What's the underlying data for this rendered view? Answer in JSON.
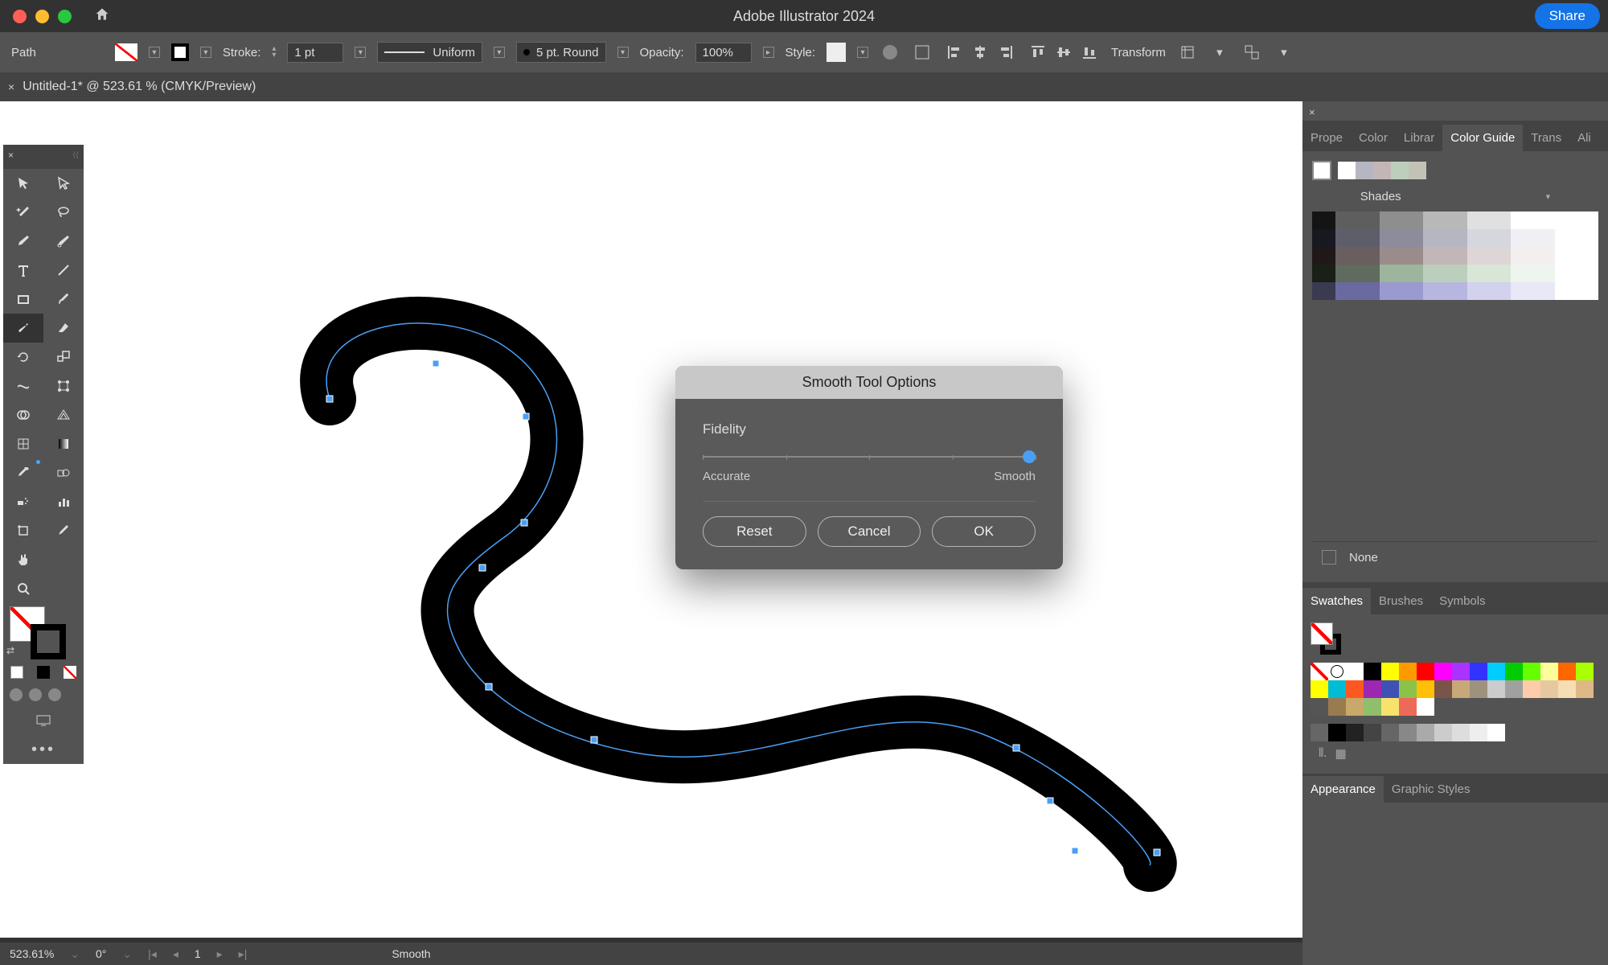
{
  "app": {
    "title": "Adobe Illustrator 2024",
    "share": "Share"
  },
  "control": {
    "selection": "Path",
    "stroke_label": "Stroke:",
    "stroke_weight": "1 pt",
    "profile": "Uniform",
    "var_width": "5 pt. Round",
    "opacity_label": "Opacity:",
    "opacity_value": "100%",
    "style_label": "Style:",
    "transform": "Transform"
  },
  "tab": {
    "close": "×",
    "name": "Untitled-1* @ 523.61 % (CMYK/Preview)"
  },
  "dialog": {
    "title": "Smooth Tool Options",
    "fidelity": "Fidelity",
    "accurate": "Accurate",
    "smooth": "Smooth",
    "slider_value": 100,
    "reset": "Reset",
    "cancel": "Cancel",
    "ok": "OK"
  },
  "panels": {
    "tabs": [
      "Prope",
      "Color",
      "Librar",
      "Color Guide",
      "Trans",
      "Ali"
    ],
    "active_tab": "Color Guide",
    "shades": "Shades",
    "none": "None",
    "tabs2": [
      "Swatches",
      "Brushes",
      "Symbols"
    ],
    "active_tab2": "Swatches",
    "tabs3": [
      "Appearance",
      "Graphic Styles"
    ],
    "active_tab3": "Appearance"
  },
  "colorguide": {
    "harmony": [
      "#ffffff",
      "#b6b6c2",
      "#c2b6b6",
      "#bccfbc",
      "#c2c2b6"
    ],
    "shades_grid": [
      [
        "#141414",
        "#5e5e5e",
        "#8e8e8e",
        "#b8b8b8",
        "#e0e0e0",
        "#ffffff",
        "#ffffff"
      ],
      [
        "#181820",
        "#5e5e6b",
        "#8c8c9b",
        "#b6b6c2",
        "#d6d6de",
        "#efeff4",
        "#ffffff"
      ],
      [
        "#201818",
        "#6b5e5e",
        "#9b8c8c",
        "#c2b6b6",
        "#ded6d6",
        "#f4efef",
        "#ffffff"
      ],
      [
        "#182018",
        "#5e6b5e",
        "#9db59d",
        "#bccfbc",
        "#d8e6d8",
        "#eef5ee",
        "#ffffff"
      ],
      [
        "#3a3a50",
        "#6a6aa0",
        "#9a9ad0",
        "#b6b6e0",
        "#d2d2ee",
        "#e8e8f6",
        "#ffffff"
      ]
    ]
  },
  "swatches": {
    "row1": [
      "#ffffff",
      "#000000",
      "#ffff00",
      "#ff9900",
      "#ff0000",
      "#ff00ff",
      "#aa33ff",
      "#3333ff",
      "#00ccff",
      "#00cc00",
      "#66ff00",
      "#ffff99",
      "#ff6600",
      "#aaff00",
      "#ffff00"
    ],
    "row2": [
      "#00bcd4",
      "#ff5722",
      "#9c27b0",
      "#3f51b5",
      "#8bc34a",
      "#ffc107",
      "#795548",
      "#c8a878",
      "#9e927e",
      "#cccccc",
      "#a0a0a0",
      "#ffccaa",
      "#e6c8a0",
      "#f5deb3",
      "#deb887"
    ],
    "row3": [
      "#555555",
      "#9a7b4f",
      "#c9a86a",
      "#8fbf6a",
      "#f7e36b",
      "#ed6a5a",
      "#ffffff"
    ],
    "grays": [
      "#000000",
      "#222222",
      "#444444",
      "#666666",
      "#888888",
      "#aaaaaa",
      "#cccccc",
      "#dddddd",
      "#eeeeee",
      "#ffffff"
    ]
  },
  "status": {
    "zoom": "523.61%",
    "rotate": "0°",
    "page": "1",
    "tool": "Smooth"
  },
  "tools": {
    "left": [
      "selection",
      "pen",
      "type",
      "rectangle",
      "pencil",
      "eraser",
      "rotate",
      "width",
      "shape-builder",
      "mesh",
      "eyedropper",
      "symbol-sprayer",
      "column-graph",
      "artboard",
      "slice",
      "hand",
      "zoom"
    ],
    "right": [
      "direct-selection",
      "curvature",
      "line",
      "paintbrush",
      "scissors",
      "shaper",
      "free-transform",
      "puppet",
      "perspective",
      "gradient",
      "blend",
      "crop",
      "print-tiling",
      "slice-select",
      "move",
      "more"
    ]
  }
}
